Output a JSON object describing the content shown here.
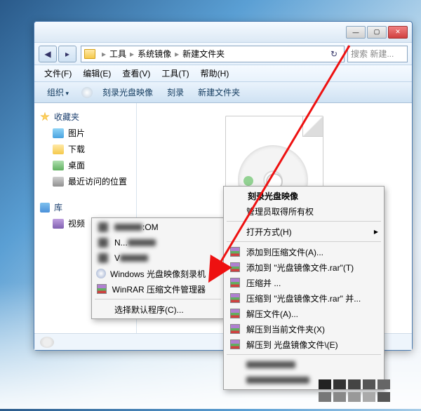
{
  "window": {
    "min": "—",
    "max": "▢",
    "close": "✕",
    "nav_back": "◀",
    "nav_fwd": "▸",
    "path": [
      "工具",
      "系统镜像",
      "新建文件夹"
    ],
    "search_placeholder": "搜索 新建..."
  },
  "menubar": [
    "文件(F)",
    "编辑(E)",
    "查看(V)",
    "工具(T)",
    "帮助(H)"
  ],
  "toolbar": {
    "organize": "组织",
    "burn_image": "刻录光盘映像",
    "burn": "刻录",
    "new_folder": "新建文件夹"
  },
  "nav": {
    "favorites": "收藏夹",
    "fav_items": [
      "图片",
      "下载",
      "桌面",
      "最近访问的位置"
    ],
    "libraries": "库",
    "lib_items": [
      "视频"
    ]
  },
  "ctx_openwith": {
    "hidden1": ":OM",
    "hidden2": "N...",
    "hidden3": "V",
    "burner": "Windows 光盘映像刻录机",
    "winrar": "WinRAR 压缩文件管理器",
    "choose": "选择默认程序(C)..."
  },
  "ctx_main": {
    "title": "刻录光盘映像",
    "admin": "管理员取得所有权",
    "open_with": "打开方式(H)",
    "add_archive": "添加到压缩文件(A)...",
    "add_to_named": "添加到 \"光盘镜像文件.rar\"(T)",
    "compress_email": "压缩并 ...",
    "compress_named_email": "压缩到 \"光盘镜像文件.rar\" 并...",
    "extract": "解压文件(A)...",
    "extract_here": "解压到当前文件夹(X)",
    "extract_to": "解压到 光盘镜像文件\\(E)"
  }
}
